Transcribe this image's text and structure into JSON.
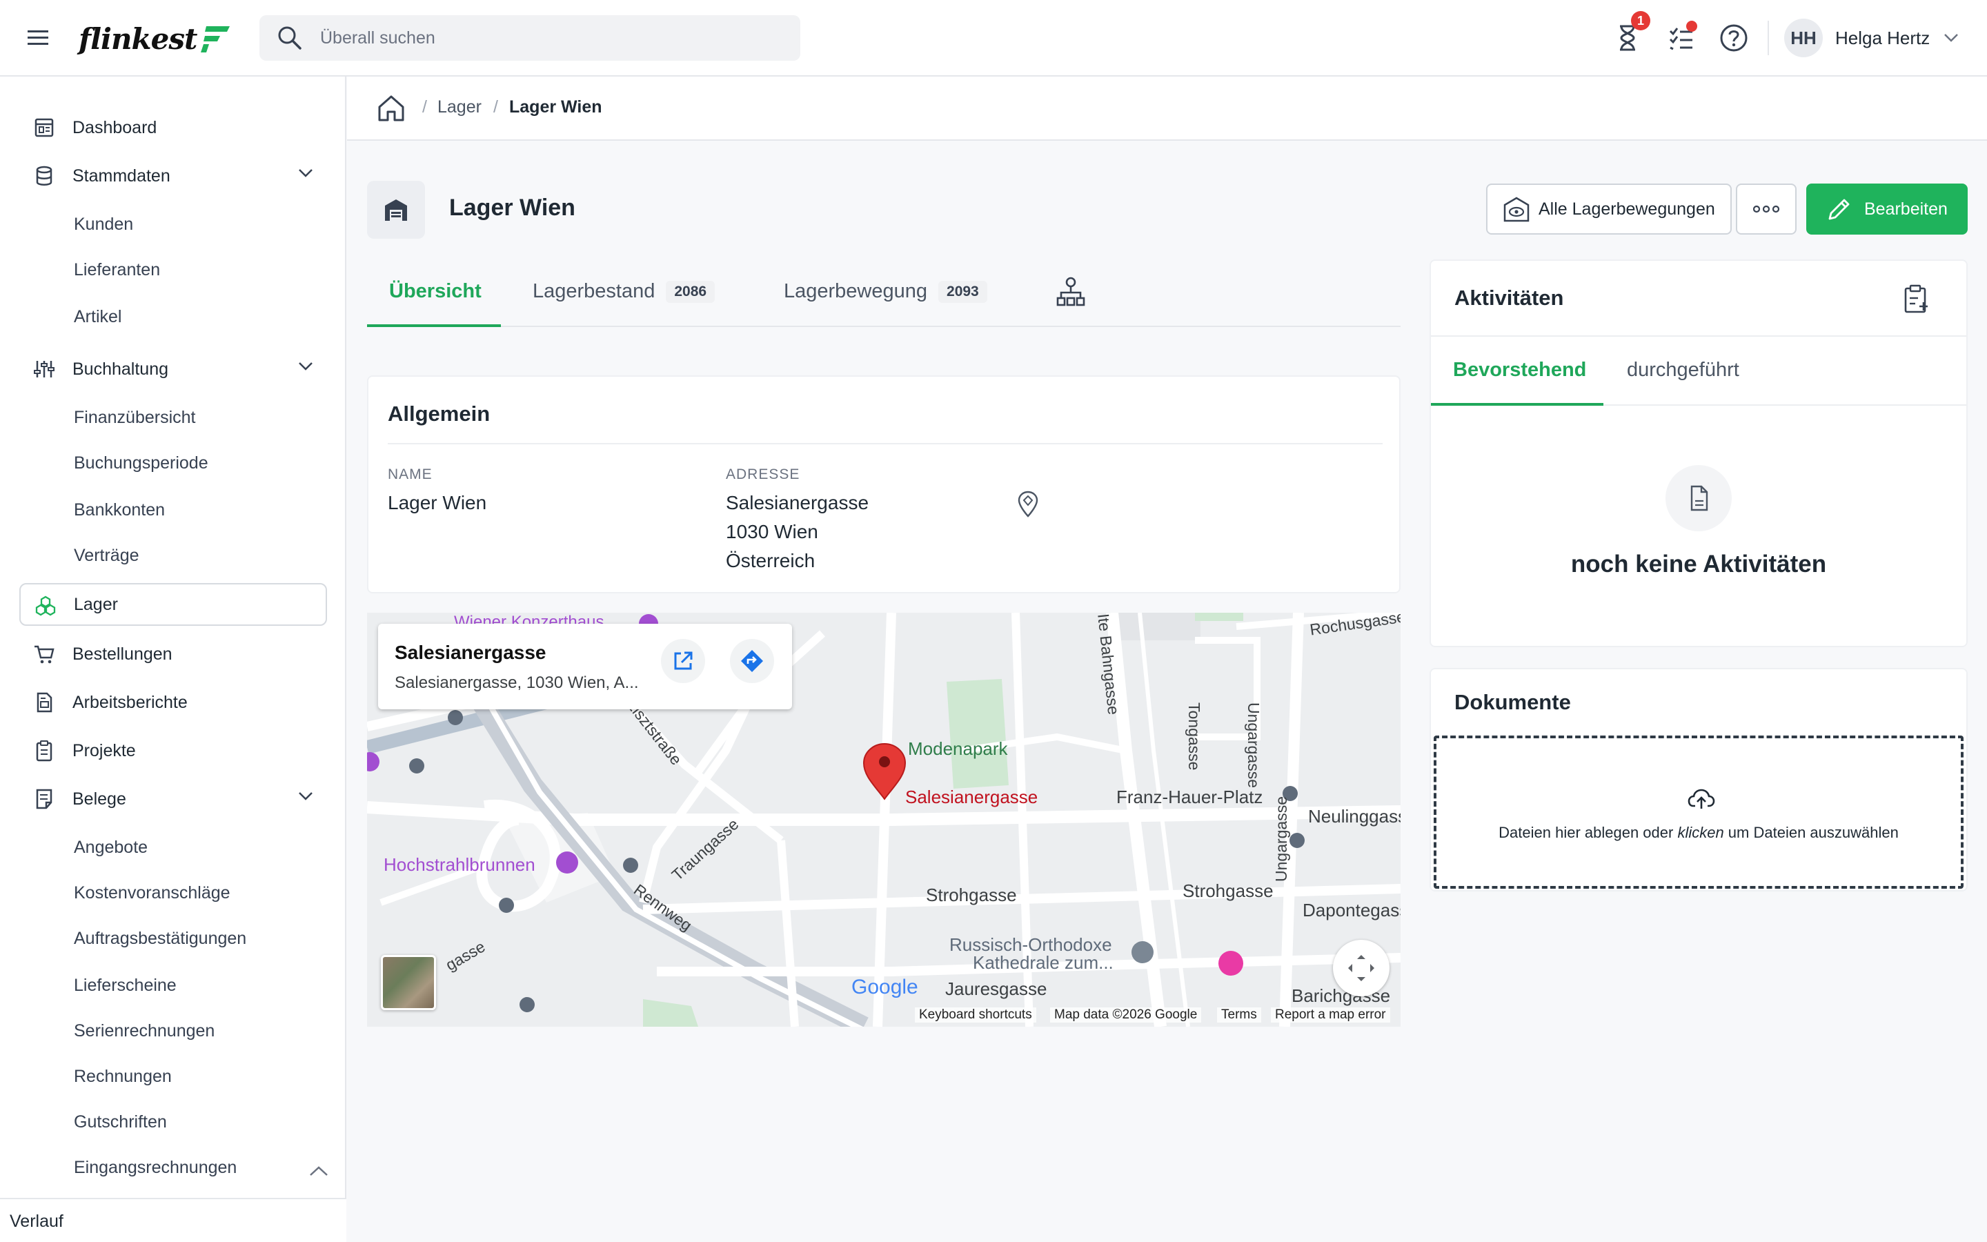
{
  "app": {
    "logo_text": "flinkest"
  },
  "search": {
    "placeholder": "Überall suchen"
  },
  "header": {
    "notifications_count": "1",
    "user_initials": "HH",
    "user_name": "Helga Hertz"
  },
  "sidebar": {
    "items": [
      {
        "label": "Dashboard"
      },
      {
        "label": "Stammdaten"
      },
      {
        "label": "Kunden"
      },
      {
        "label": "Lieferanten"
      },
      {
        "label": "Artikel"
      },
      {
        "label": "Buchhaltung"
      },
      {
        "label": "Finanzübersicht"
      },
      {
        "label": "Buchungsperiode"
      },
      {
        "label": "Bankkonten"
      },
      {
        "label": "Verträge"
      },
      {
        "label": "Lager"
      },
      {
        "label": "Bestellungen"
      },
      {
        "label": "Arbeitsberichte"
      },
      {
        "label": "Projekte"
      },
      {
        "label": "Belege"
      },
      {
        "label": "Angebote"
      },
      {
        "label": "Kostenvoranschläge"
      },
      {
        "label": "Auftragsbestätigungen"
      },
      {
        "label": "Lieferscheine"
      },
      {
        "label": "Serienrechnungen"
      },
      {
        "label": "Rechnungen"
      },
      {
        "label": "Gutschriften"
      },
      {
        "label": "Eingangsrechnungen"
      }
    ],
    "footer_label": "Verlauf"
  },
  "breadcrumb": {
    "sep": "/",
    "level1": "Lager",
    "current": "Lager Wien"
  },
  "page": {
    "title": "Lager Wien",
    "btn_all_movements": "Alle Lagerbewegungen",
    "btn_edit": "Bearbeiten"
  },
  "tabs": [
    {
      "label": "Übersicht"
    },
    {
      "label": "Lagerbestand",
      "count": "2086"
    },
    {
      "label": "Lagerbewegung",
      "count": "2093"
    }
  ],
  "general": {
    "title": "Allgemein",
    "name_label": "NAME",
    "name_value": "Lager Wien",
    "address_label": "ADRESSE",
    "address_line1": "Salesianergasse",
    "address_line2": "1030 Wien",
    "address_line3": "Österreich"
  },
  "map": {
    "info_title": "Salesianergasse",
    "info_subtitle": "Salesianergasse, 1030 Wien, A...",
    "labels": [
      "Wiener Konzerthaus",
      "Rochusgasse",
      "Lisztstraße",
      "Modenapark",
      "Salesianergasse",
      "Franz-Hauer-Platz",
      "Neulinggasse",
      "Hochstrahlbrunnen",
      "Traungasse",
      "Rennweg",
      "Strohgasse",
      "Strohgasse",
      "Dapontegasse",
      "Russisch-Orthodoxe",
      "Kathedrale zum...",
      "Jauresgasse",
      "Barichgasse",
      "Ungargasse",
      "Ungargasse",
      "Tongasse",
      "Ite Bahngasse",
      "gasse"
    ],
    "google": "Google",
    "footer_shortcuts": "Keyboard shortcuts",
    "footer_data": "Map data ©2026 Google",
    "footer_terms": "Terms",
    "footer_report": "Report a map error"
  },
  "activities": {
    "title": "Aktivitäten",
    "tab_upcoming": "Bevorstehend",
    "tab_done": "durchgeführt",
    "empty": "noch keine Aktivitäten"
  },
  "documents": {
    "title": "Dokumente",
    "drop_text_a": "Dateien hier ablegen oder ",
    "drop_text_em": "klicken",
    "drop_text_b": " um Dateien auszuwählen"
  },
  "colors": {
    "accent": "#1fb35c",
    "pin": "#e53935"
  }
}
